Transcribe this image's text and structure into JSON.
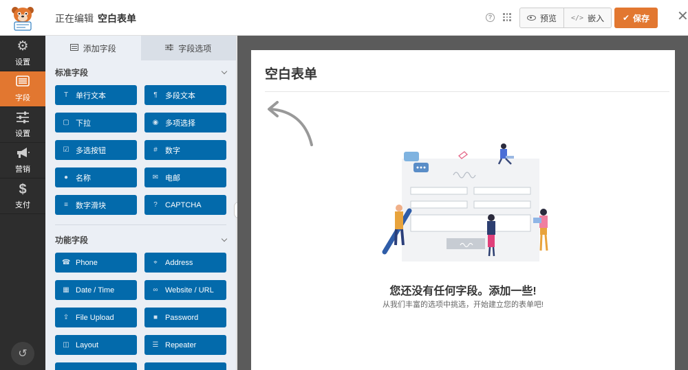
{
  "header": {
    "editing_label": "正在编辑",
    "form_name": "空白表单",
    "help_icon": "question-circle-icon",
    "preview_label": "预览",
    "embed_label": "嵌入",
    "save_label": "保存",
    "accent": "#e27730"
  },
  "sidebar": {
    "items": [
      {
        "icon": "gear-icon",
        "label": "设置"
      },
      {
        "icon": "fields-list-icon",
        "label": "字段"
      },
      {
        "icon": "sliders-icon",
        "label": "设置"
      },
      {
        "icon": "megaphone-icon",
        "label": "营销"
      },
      {
        "icon": "dollar-icon",
        "label": "支付"
      }
    ],
    "active_index": 1
  },
  "panel": {
    "tabs": [
      {
        "label": "添加字段",
        "icon": "list-icon"
      },
      {
        "label": "字段选项",
        "icon": "sliders-icon"
      }
    ],
    "standard": {
      "title": "标准字段",
      "fields": [
        {
          "icon": "T",
          "label": "单行文本"
        },
        {
          "icon": "¶",
          "label": "多段文本"
        },
        {
          "icon": "▢",
          "label": "下拉"
        },
        {
          "icon": "◉",
          "label": "多项选择"
        },
        {
          "icon": "☑",
          "label": "多选按钮"
        },
        {
          "icon": "#",
          "label": "数字"
        },
        {
          "icon": "●",
          "label": "名称"
        },
        {
          "icon": "✉",
          "label": "电邮"
        },
        {
          "icon": "≡",
          "label": "数字滑块"
        },
        {
          "icon": "?",
          "label": "CAPTCHA"
        }
      ]
    },
    "fancy": {
      "title": "功能字段",
      "fields": [
        {
          "icon": "☎",
          "label": "Phone"
        },
        {
          "icon": "⌖",
          "label": "Address"
        },
        {
          "icon": "▦",
          "label": "Date / Time"
        },
        {
          "icon": "∞",
          "label": "Website / URL"
        },
        {
          "icon": "⇪",
          "label": "File Upload"
        },
        {
          "icon": "■",
          "label": "Password"
        },
        {
          "icon": "◫",
          "label": "Layout"
        },
        {
          "icon": "☰",
          "label": "Repeater"
        }
      ]
    }
  },
  "preview": {
    "title": "空白表单",
    "empty_heading": "您还没有任何字段。添加一些!",
    "empty_sub": "从我们丰富的选项中挑选，开始建立您的表单吧!"
  }
}
